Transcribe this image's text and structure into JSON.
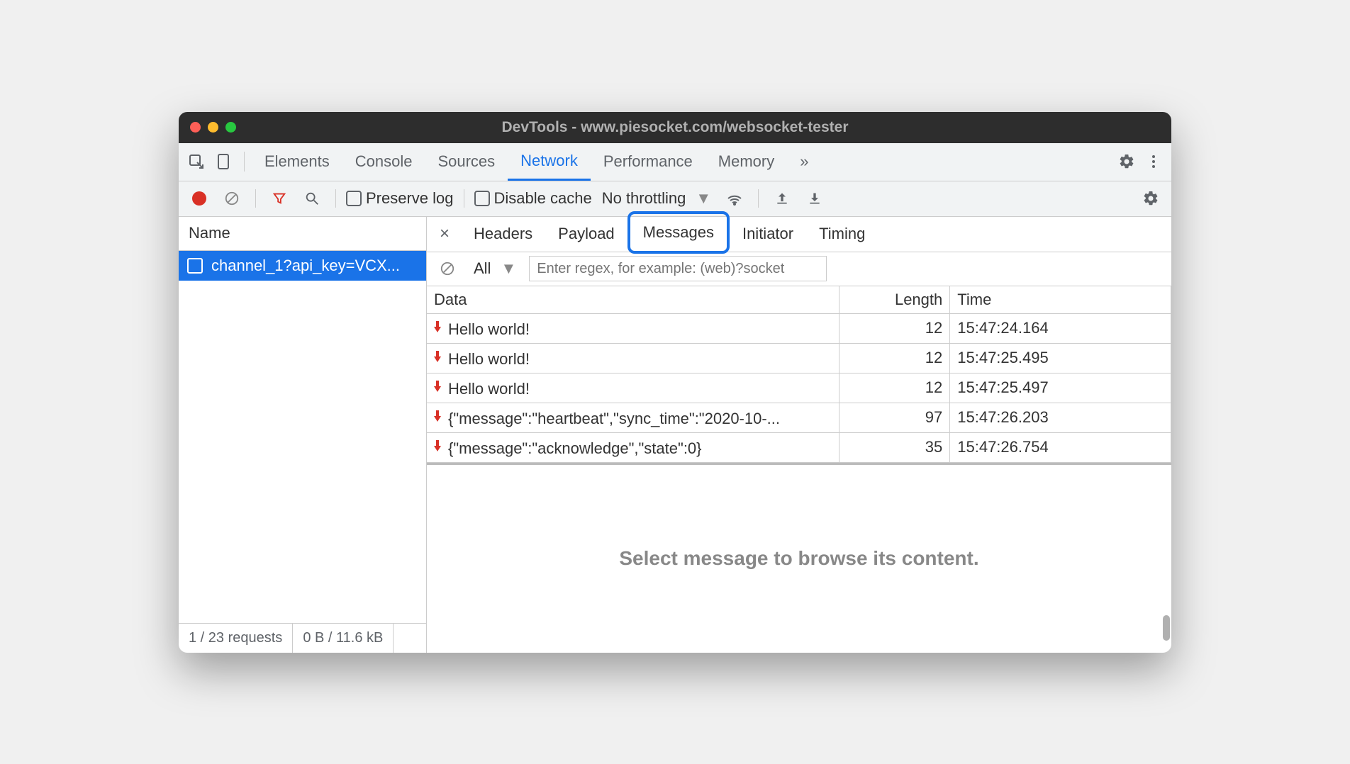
{
  "window": {
    "title": "DevTools - www.piesocket.com/websocket-tester"
  },
  "mainTabs": {
    "items": [
      "Elements",
      "Console",
      "Sources",
      "Network",
      "Performance",
      "Memory"
    ],
    "activeIndex": 3
  },
  "toolbar": {
    "preserveLog": "Preserve log",
    "disableCache": "Disable cache",
    "throttling": "No throttling"
  },
  "sidebar": {
    "header": "Name",
    "request": "channel_1?api_key=VCX...",
    "footer": {
      "requests": "1 / 23 requests",
      "transfer": "0 B / 11.6 kB"
    }
  },
  "detailTabs": {
    "items": [
      "Headers",
      "Payload",
      "Messages",
      "Initiator",
      "Timing"
    ],
    "activeIndex": 2
  },
  "filter": {
    "type": "All",
    "regexPlaceholder": "Enter regex, for example: (web)?socket"
  },
  "columns": {
    "data": "Data",
    "length": "Length",
    "time": "Time"
  },
  "messages": [
    {
      "dir": "down",
      "data": "Hello world!",
      "length": 12,
      "time": "15:47:24.164"
    },
    {
      "dir": "down",
      "data": "Hello world!",
      "length": 12,
      "time": "15:47:25.495"
    },
    {
      "dir": "down",
      "data": "Hello world!",
      "length": 12,
      "time": "15:47:25.497"
    },
    {
      "dir": "down",
      "data": "{\"message\":\"heartbeat\",\"sync_time\":\"2020-10-...",
      "length": 97,
      "time": "15:47:26.203"
    },
    {
      "dir": "down",
      "data": "{\"message\":\"acknowledge\",\"state\":0}",
      "length": 35,
      "time": "15:47:26.754"
    }
  ],
  "placeholder": "Select message to browse its content."
}
